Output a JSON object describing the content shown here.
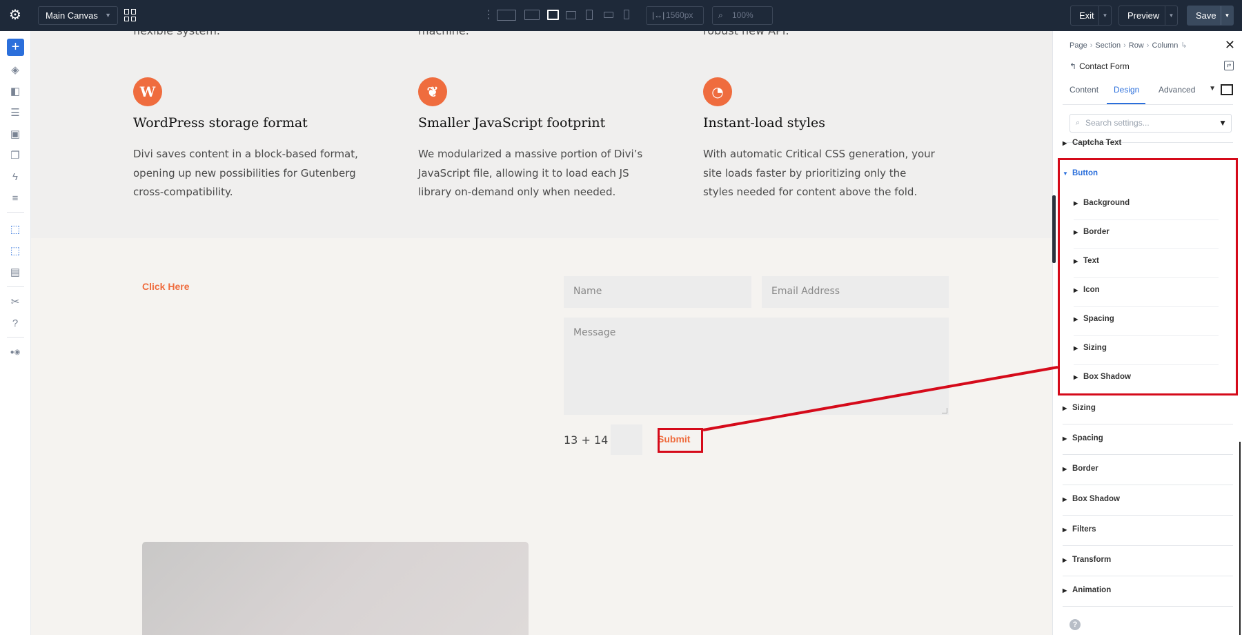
{
  "topbar": {
    "canvas_select": "Main Canvas",
    "width_value": "1560px",
    "zoom_value": "100%",
    "exit_label": "Exit",
    "preview_label": "Preview",
    "save_label": "Save"
  },
  "canvas": {
    "cut_texts": [
      "flexible system.",
      "machine.",
      "robust new API."
    ],
    "features": [
      {
        "icon": "wordpress-icon",
        "glyph": "W",
        "title": "WordPress storage format",
        "body": "Divi saves content in a block-based format, opening up new possibilities for Gutenberg cross-compatibility."
      },
      {
        "icon": "feather-icon",
        "glyph": "❦",
        "title": "Smaller JavaScript footprint",
        "body": "We modularized a massive portion of Divi’s JavaScript file, allowing it to load each JS library on-demand only when needed."
      },
      {
        "icon": "speedometer-icon",
        "glyph": "◔",
        "title": "Instant-load styles",
        "body": "With automatic Critical CSS generation, your site loads faster by prioritizing only the styles needed for content above the fold."
      }
    ],
    "click_here": "Click Here",
    "form": {
      "name_placeholder": "Name",
      "email_placeholder": "Email Address",
      "message_placeholder": "Message",
      "captcha": "13 + 14 =",
      "submit": "Submit"
    }
  },
  "panel": {
    "breadcrumb": [
      "Page",
      "Section",
      "Row",
      "Column"
    ],
    "module_name": "Contact Form",
    "tabs": [
      "Content",
      "Design",
      "Advanced"
    ],
    "active_tab": "Design",
    "search_placeholder": "Search settings...",
    "groups_top": [
      "Captcha Text"
    ],
    "button_group": {
      "label": "Button",
      "children": [
        "Background",
        "Border",
        "Text",
        "Icon",
        "Spacing",
        "Sizing",
        "Box Shadow"
      ]
    },
    "groups_bottom": [
      "Sizing",
      "Spacing",
      "Border",
      "Box Shadow",
      "Filters",
      "Transform",
      "Animation"
    ]
  },
  "colors": {
    "accent": "#ef6c3e",
    "brand_blue": "#2b6fdb",
    "highlight_red": "#d50a1a",
    "topbar_bg": "#1e2939"
  }
}
